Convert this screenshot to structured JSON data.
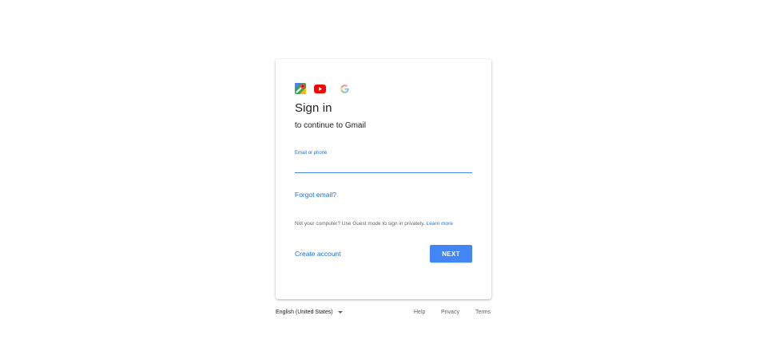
{
  "card": {
    "logos": [
      "maps-icon",
      "youtube-icon",
      "google-icon"
    ],
    "title": "Sign in",
    "subtitle": "to continue to Gmail",
    "email_field": {
      "label": "Email or phone",
      "value": ""
    },
    "forgot_email": "Forgot email?",
    "guest_text": "Not your computer? Use Guest mode to sign in privately.",
    "learn_more": "Learn more",
    "create_account": "Create account",
    "next_button": "NEXT"
  },
  "footer": {
    "language": "English (United States)",
    "links": {
      "help": "Help",
      "privacy": "Privacy",
      "terms": "Terms"
    }
  },
  "colors": {
    "accent": "#1a73e8",
    "button": "#4285f4",
    "text": "#202124",
    "muted": "#5f6368"
  }
}
